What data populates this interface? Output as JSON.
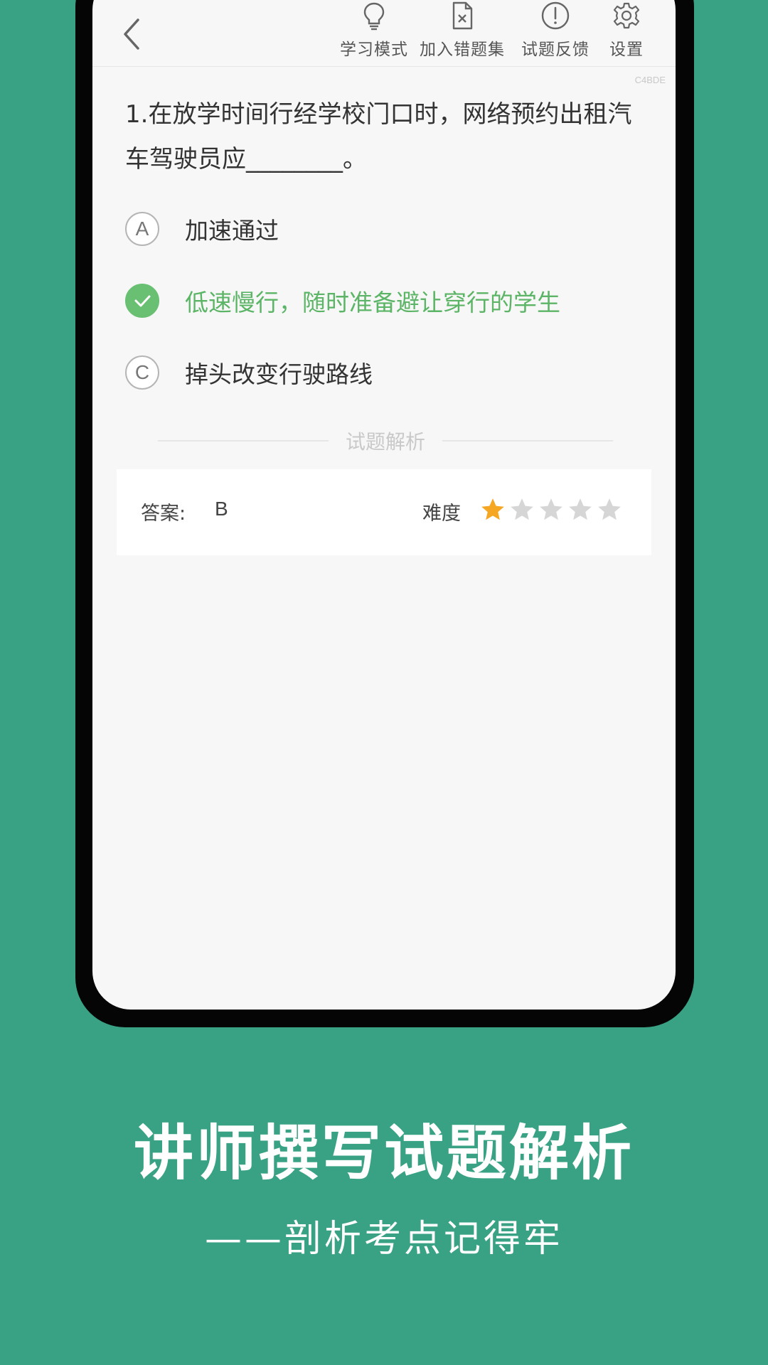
{
  "toolbar": {
    "back_icon": "chevron-left-icon",
    "items": [
      {
        "label": "学习模式",
        "icon": "lightbulb-icon"
      },
      {
        "label": "加入错题集",
        "icon": "document-x-icon"
      },
      {
        "label": "试题反馈",
        "icon": "exclamation-circle-icon"
      },
      {
        "label": "设置",
        "icon": "gear-icon"
      }
    ]
  },
  "code_tag": "C4BDE",
  "question": {
    "text": "1.在放学时间行经学校门口时，网络预约出租汽车驾驶员应________。"
  },
  "options": [
    {
      "letter": "A",
      "text": "加速通过",
      "state": "normal"
    },
    {
      "letter": "B",
      "text": "低速慢行，随时准备避让穿行的学生",
      "state": "correct"
    },
    {
      "letter": "C",
      "text": "掉头改变行驶路线",
      "state": "normal"
    }
  ],
  "analysis": {
    "divider_title": "试题解析",
    "answer_label": "答案:",
    "answer_value": "B",
    "difficulty_label": "难度",
    "difficulty_rating": 1,
    "difficulty_max": 5
  },
  "colors": {
    "background": "#3aa284",
    "correct": "#69bf72",
    "star_active": "#f5a623",
    "star_inactive": "#d6d6d6"
  },
  "promo": {
    "headline": "讲师撰写试题解析",
    "subline": "——剖析考点记得牢"
  }
}
